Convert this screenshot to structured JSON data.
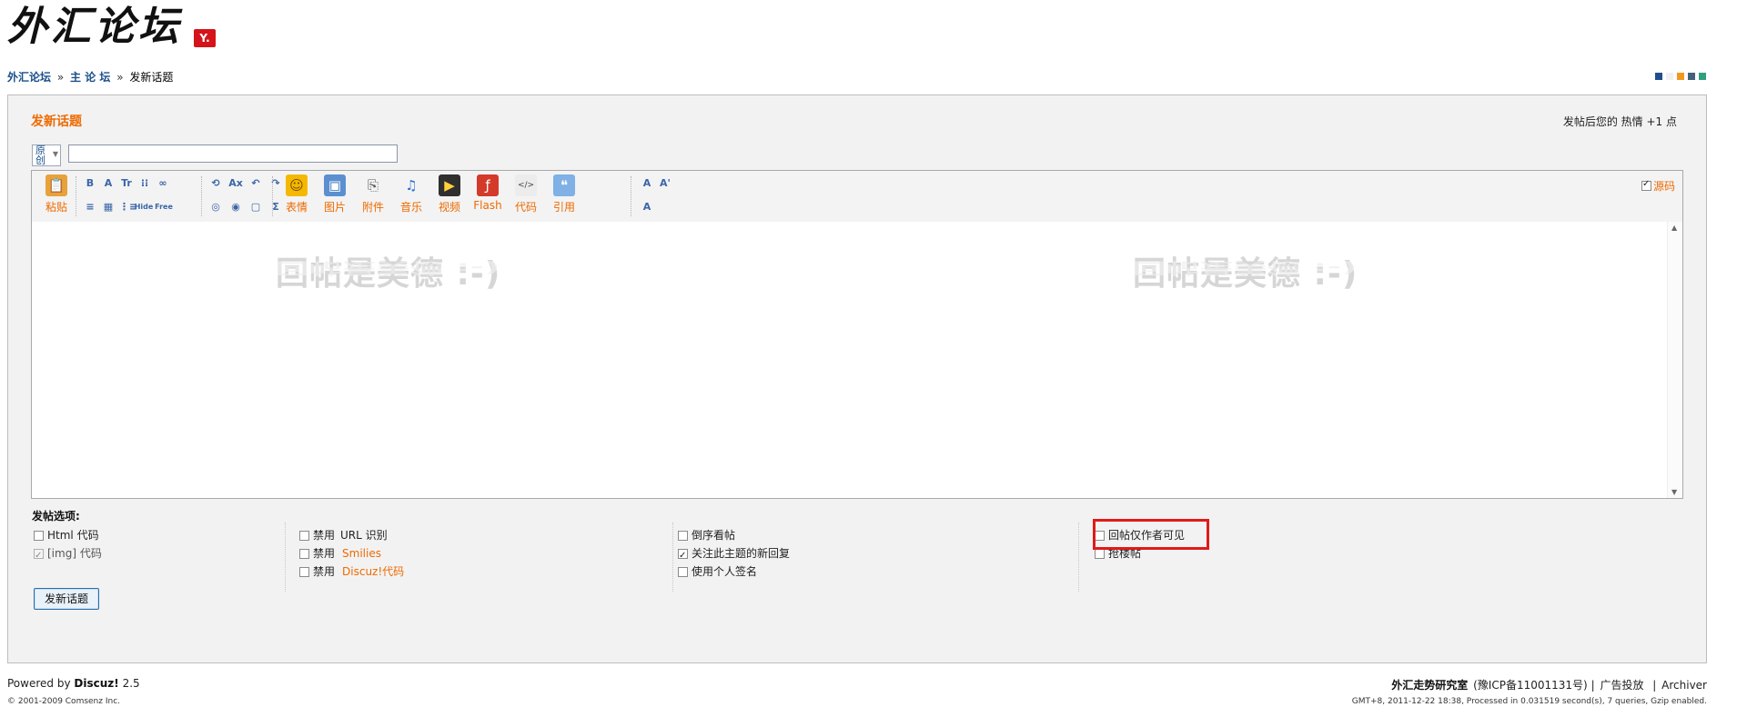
{
  "header": {
    "logo_text": "外汇论坛",
    "logo_badge": "Y."
  },
  "breadcrumb": {
    "home": "外汇论坛",
    "sep1": "»",
    "forum": "主 论 坛",
    "sep2": "»",
    "current": "发新话题"
  },
  "style_switch": {
    "colors": [
      "#1f4e8c",
      "#f0f0f0",
      "#f09820",
      "#45607a",
      "#2fa07d"
    ]
  },
  "form": {
    "title": "发新话题",
    "hot_info": "发帖后您的 热情 +1 点",
    "type_select": "原创",
    "subject_value": ""
  },
  "editor": {
    "small_tools_row1": [
      "B",
      "A",
      "Tr",
      "⁝⁝",
      "∞",
      "⟲",
      "Ax",
      "↶",
      "↷",
      "A",
      "A'"
    ],
    "small_tools_row2": [
      "≡",
      "▦",
      "⋮≡",
      "Hide",
      "Free",
      "◎",
      "◉",
      "▢",
      "Σ",
      "A"
    ],
    "paste_label": "粘贴",
    "big_tools": [
      {
        "label": "表情",
        "icon": "smiley-icon"
      },
      {
        "label": "图片",
        "icon": "image-icon"
      },
      {
        "label": "附件",
        "icon": "paperclip-icon"
      },
      {
        "label": "音乐",
        "icon": "music-icon"
      },
      {
        "label": "视频",
        "icon": "video-icon"
      },
      {
        "label": "Flash",
        "icon": "flash-icon"
      },
      {
        "label": "代码",
        "icon": "code-icon"
      },
      {
        "label": "引用",
        "icon": "quote-icon"
      }
    ],
    "source_label": "源码",
    "source_checked": true,
    "watermark": "回帖是美德 :-)"
  },
  "options": {
    "title": "发帖选项:",
    "col1": [
      {
        "label": "Html 代码",
        "checked": false,
        "disabled": false
      },
      {
        "label": "[img] 代码",
        "checked": true,
        "disabled": true
      }
    ],
    "col2": [
      {
        "prefix": "禁用",
        "label": "URL 识别",
        "highlight": false,
        "checked": false
      },
      {
        "prefix": "禁用",
        "label": "Smilies",
        "highlight": true,
        "checked": false
      },
      {
        "prefix": "禁用",
        "label": "Discuz!代码",
        "highlight": true,
        "checked": false
      }
    ],
    "col3": [
      {
        "label": "倒序看帖",
        "checked": false
      },
      {
        "label": "关注此主题的新回复",
        "checked": true
      },
      {
        "label": "使用个人签名",
        "checked": false
      }
    ],
    "col4": [
      {
        "label": "回帖仅作者可见",
        "checked": false
      },
      {
        "label": "抢楼帖",
        "checked": false
      }
    ]
  },
  "submit_label": "发新话题",
  "footer": {
    "powered": "Powered by",
    "product": "Discuz!",
    "version": "2.5",
    "copyright": "© 2001-2009 Comsenz Inc.",
    "site_name": "外汇走势研究室",
    "icp": "(豫ICP备11001131号)",
    "ad_link": "广告投放",
    "archiver_link": "Archiver",
    "sep": "|",
    "timing": "GMT+8, 2011-12-22 18:38, Processed in 0.031519 second(s), 7 queries, Gzip enabled."
  }
}
